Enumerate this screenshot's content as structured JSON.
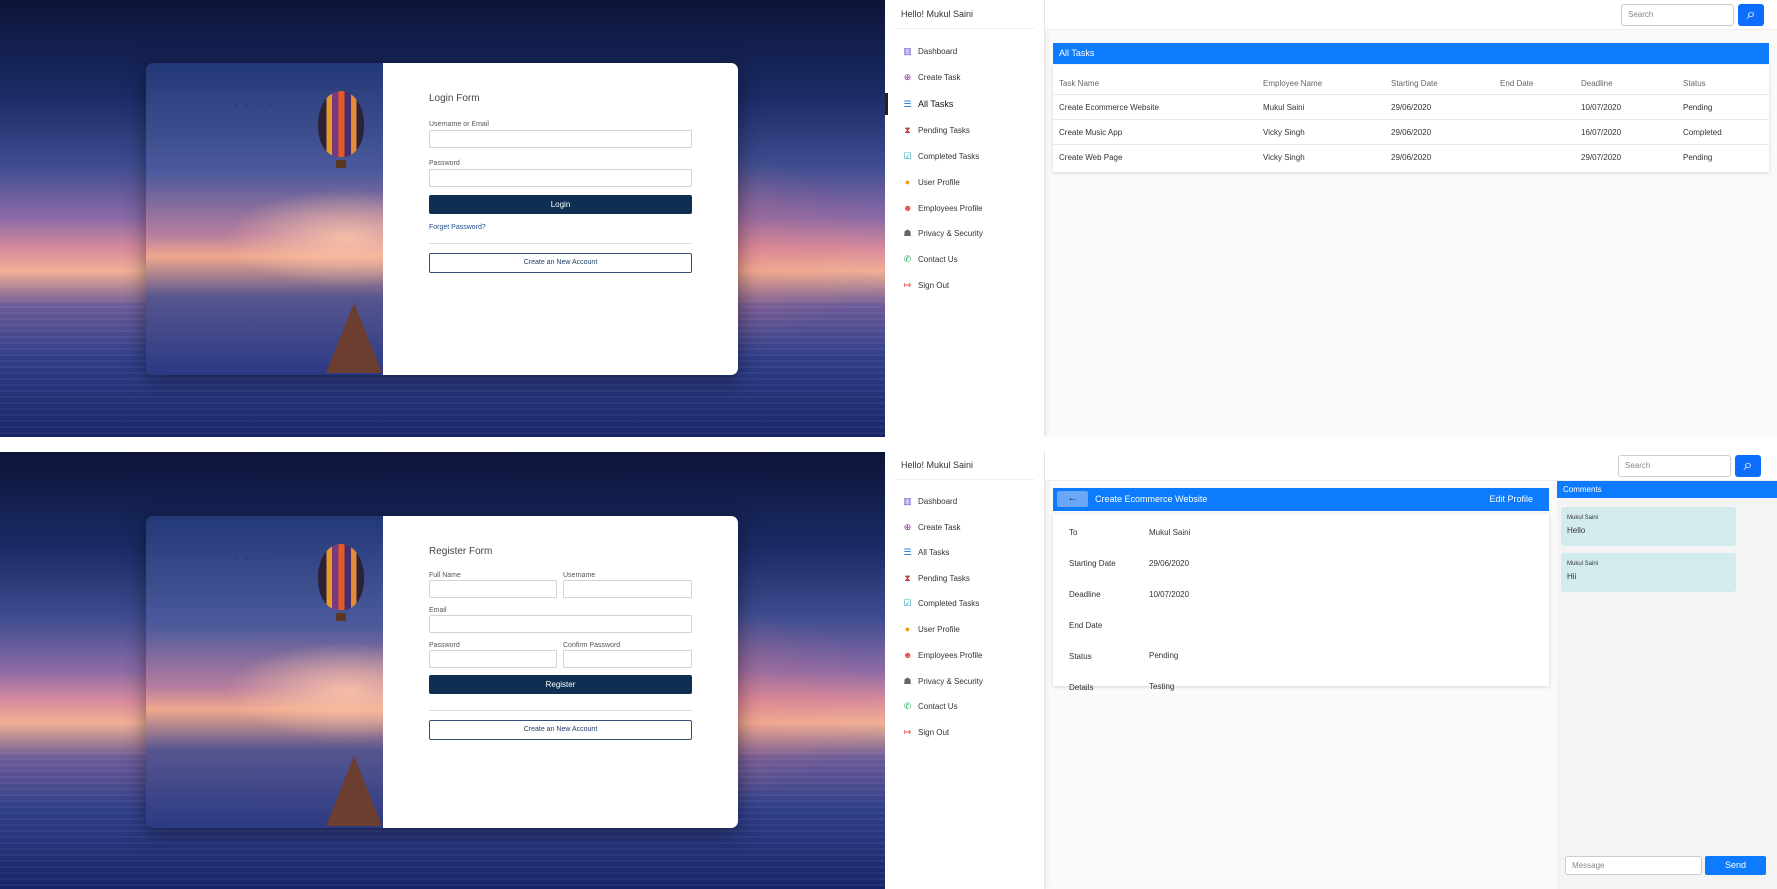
{
  "user": {
    "greeting": "Hello! Mukul Saini"
  },
  "login": {
    "title": "Login Form",
    "username_label": "Username or Email",
    "password_label": "Password",
    "login_button": "Login",
    "forgot_link": "Forget Password?",
    "create_account_button": "Create an New Account"
  },
  "register": {
    "title": "Register Form",
    "fullname_label": "Full Name",
    "username_label": "Username",
    "email_label": "Email",
    "password_label": "Password",
    "confirm_label": "Confirm Password",
    "register_button": "Register",
    "create_account_button": "Create an New Account"
  },
  "sidebar": {
    "items": [
      {
        "label": "Dashboard",
        "icon": "dashboard-icon"
      },
      {
        "label": "Create Task",
        "icon": "plus-circle-icon"
      },
      {
        "label": "All Tasks",
        "icon": "list-icon"
      },
      {
        "label": "Pending Tasks",
        "icon": "hourglass-icon"
      },
      {
        "label": "Completed Tasks",
        "icon": "check-clipboard-icon"
      },
      {
        "label": "User Profile",
        "icon": "user-icon"
      },
      {
        "label": "Employees Profile",
        "icon": "users-icon"
      },
      {
        "label": "Privacy & Security",
        "icon": "user-lock-icon"
      },
      {
        "label": "Contact Us",
        "icon": "phone-icon"
      },
      {
        "label": "Sign Out",
        "icon": "sign-out-icon"
      }
    ]
  },
  "search": {
    "placeholder": "Search"
  },
  "all_tasks": {
    "title": "All Tasks",
    "columns": [
      "Task Name",
      "Employee Name",
      "Starting Date",
      "End Date",
      "Deadline",
      "Status"
    ],
    "rows": [
      [
        "Create Ecommerce Website",
        "Mukul Saini",
        "29/06/2020",
        "",
        "10/07/2020",
        "Pending"
      ],
      [
        "Create Music App",
        "Vicky Singh",
        "29/06/2020",
        "",
        "16/07/2020",
        "Completed"
      ],
      [
        "Create Web Page",
        "Vicky Singh",
        "29/06/2020",
        "",
        "29/07/2020",
        "Pending"
      ]
    ]
  },
  "task_detail": {
    "back_icon": "←",
    "title": "Create Ecommerce Website",
    "edit_button": "Edit Profile",
    "fields": [
      {
        "label": "To",
        "value": "Mukul Saini"
      },
      {
        "label": "Starting Date",
        "value": "29/06/2020"
      },
      {
        "label": "Deadline",
        "value": "10/07/2020"
      },
      {
        "label": "End Date",
        "value": ""
      },
      {
        "label": "Status",
        "value": "Pending"
      },
      {
        "label": "Details",
        "value": "Testing"
      }
    ]
  },
  "comments": {
    "title": "Comments",
    "items": [
      {
        "author": "Mukul Saini",
        "text": "Hello"
      },
      {
        "author": "Mukul Saini",
        "text": "Hii"
      }
    ],
    "message_placeholder": "Message",
    "send_button": "Send"
  },
  "colors": {
    "primary": "#0d7bfd",
    "dark_button": "#0f2f52",
    "comment_bg": "#d2ecee"
  }
}
